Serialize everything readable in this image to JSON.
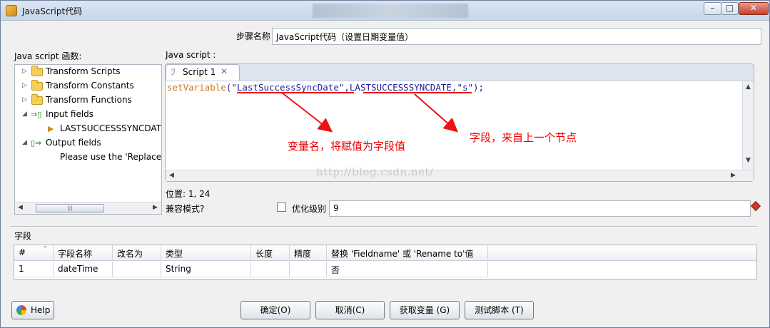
{
  "window": {
    "title": "JavaScript代码",
    "controls": {
      "minimize": "–",
      "maximize": "□",
      "close": "✕"
    }
  },
  "step_name": {
    "label": "步骤名称",
    "value": "JavaScript代码（设置日期变量值）"
  },
  "functions_panel": {
    "label": "Java script 函数:",
    "items": [
      {
        "label": "Transform Scripts",
        "icon": "folder-icon",
        "expander": "▷"
      },
      {
        "label": "Transform Constants",
        "icon": "folder-icon",
        "expander": "▷"
      },
      {
        "label": "Transform Functions",
        "icon": "folder-icon",
        "expander": "▷"
      },
      {
        "label": "Input fields",
        "icon": "input-fields-icon",
        "expander": "◢"
      },
      {
        "label": "LASTSUCCESSSYNCDATE",
        "icon": "field-arrow-icon",
        "expander": ""
      },
      {
        "label": "Output fields",
        "icon": "output-fields-icon",
        "expander": "◢"
      },
      {
        "label": "Please use the 'Replace v",
        "icon": "",
        "expander": ""
      }
    ]
  },
  "editor": {
    "label": "Java script :",
    "tab_label": "Script 1",
    "code_fn": "setVariable",
    "code_open": "(",
    "code_arg1": "\"LastSuccessSyncDate\"",
    "code_sep1": ",",
    "code_arg2": "LASTSUCCESSSYNCDATE",
    "code_sep2": ",",
    "code_arg3": "\"s\"",
    "code_close": ");",
    "watermark": "http://blog.csdn.net/"
  },
  "annotations": {
    "variable_note": "变量名，将赋值为字段值",
    "field_note": "字段，来自上一个节点"
  },
  "position": {
    "text": "位置: 1, 24"
  },
  "compatibility": {
    "label": "兼容模式?",
    "checked": false,
    "optimize_label": "优化级别",
    "optimize_value": "9"
  },
  "fields_section": {
    "label": "字段",
    "columns": [
      "#",
      "字段名称",
      "改名为",
      "类型",
      "长度",
      "精度",
      "替换 'Fieldname' 或 'Rename to'值"
    ],
    "rows": [
      [
        "1",
        "dateTime",
        "",
        "String",
        "",
        "",
        "否"
      ]
    ]
  },
  "buttons": {
    "help": "Help",
    "ok": "确定(O)",
    "cancel": "取消(C)",
    "get_variables": "获取变量 (G)",
    "test_script": "测试脚本 (T)"
  },
  "colors": {
    "annotation": "#e11111",
    "code_function": "#d27418",
    "code_text": "#1b1b99"
  }
}
